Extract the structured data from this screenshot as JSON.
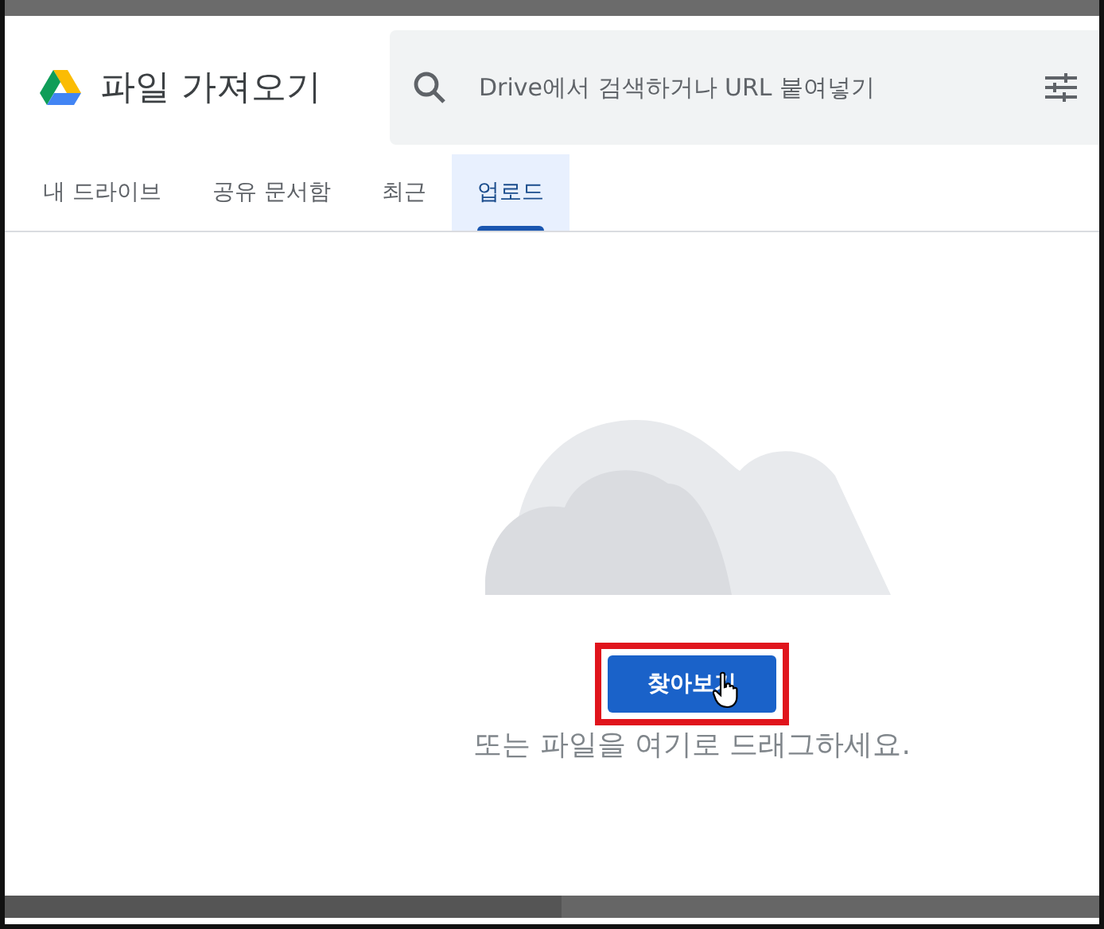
{
  "dialog": {
    "title": "파일 가져오기",
    "search": {
      "placeholder": "Drive에서 검색하거나 URL 붙여넣기"
    }
  },
  "tabs": [
    {
      "label": "내 드라이브",
      "selected": false
    },
    {
      "label": "공유 문서함",
      "selected": false
    },
    {
      "label": "최근",
      "selected": false
    },
    {
      "label": "업로드",
      "selected": true
    }
  ],
  "upload": {
    "button": "찾아보기",
    "hint": "또는 파일을 여기로 드래그하세요."
  }
}
